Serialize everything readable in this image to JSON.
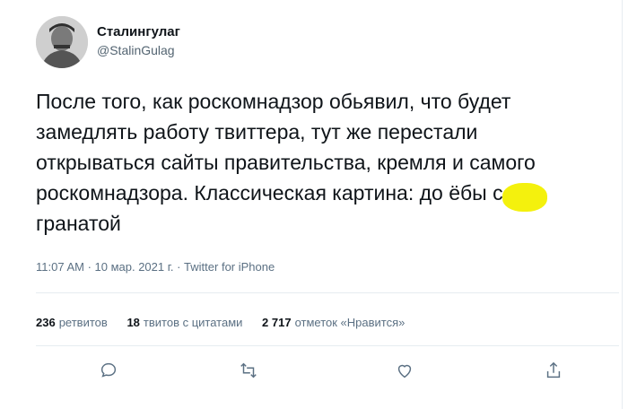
{
  "tweet": {
    "author_name": "Сталингулаг",
    "author_handle": "@StalinGulag",
    "text_lines": [
      "После того, как роскомнадзор обьявил, что будет",
      "замедлять работу твиттера, тут же перестали",
      "открываться сайты правительства, кремля и самого",
      "роскомнадзора. Классическая картина: до   ёбы с",
      "гранатой"
    ],
    "timestamp": "11:07 AM · 10 мар. 2021 г. · Twitter for iPhone"
  },
  "stats": {
    "retweets_count": "236",
    "retweets_label": "ретвитов",
    "quotes_count": "18",
    "quotes_label": "твитов с цитатами",
    "likes_count": "2 717",
    "likes_label": "отметок «Нравится»"
  },
  "actions": [
    {
      "icon": "reply-icon"
    },
    {
      "icon": "retweet-icon"
    },
    {
      "icon": "like-icon"
    },
    {
      "icon": "share-icon"
    }
  ],
  "colors": {
    "text": "#0f1419",
    "secondary": "#5b7083",
    "highlight": "#f3f000",
    "divider": "#e6ecf0"
  }
}
